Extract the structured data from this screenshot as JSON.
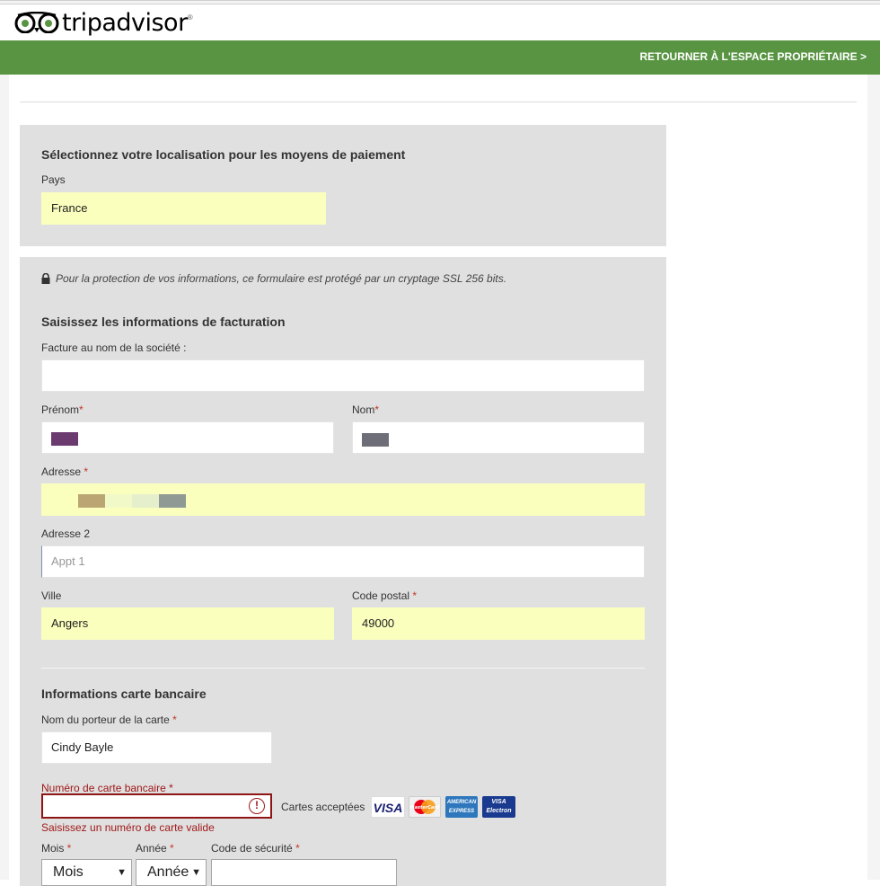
{
  "header": {
    "brand": "tripadvisor",
    "brand_reg": "®",
    "back_link": "RETOURNER À L'ESPACE PROPRIÉTAIRE >"
  },
  "colors": {
    "brand_green": "#589442",
    "panel_grey": "#e0e0e0",
    "autofill_yellow": "#faffbd",
    "error_red": "#a01818"
  },
  "location": {
    "title": "Sélectionnez votre localisation pour les moyens de paiement",
    "country_label": "Pays",
    "country_value": "France"
  },
  "billing": {
    "ssl_note": "Pour la protection de vos informations, ce formulaire est protégé par un cryptage SSL 256 bits.",
    "title": "Saisissez les informations de facturation",
    "company_label": "Facture au nom de la société :",
    "company_value": "",
    "firstname_label": "Prénom",
    "lastname_label": "Nom",
    "address_label": "Adresse ",
    "address2_label": "Adresse 2",
    "address2_placeholder": "Appt 1",
    "city_label": "Ville",
    "city_value": "Angers",
    "postal_label": "Code postal ",
    "postal_value": "49000",
    "required_mark": "*"
  },
  "card": {
    "title": "Informations carte bancaire",
    "holder_label": "Nom du porteur de la carte ",
    "holder_value": "Cindy Bayle",
    "number_label": "Numéro de carte bancaire ",
    "number_value": "",
    "error_icon": "!",
    "error_message": "Saisissez un numéro de carte valide",
    "accepted_label": "Cartes acceptées",
    "logos": [
      "VISA",
      "MasterCard",
      "AMERICAN EXPRESS",
      "VISA Electron"
    ],
    "month_label": "Mois ",
    "year_label": "Année ",
    "security_label": "Code de sécurité ",
    "month_value": "Mois",
    "year_value": "Année"
  }
}
